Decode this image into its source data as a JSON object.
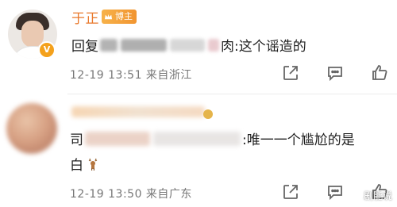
{
  "comments": [
    {
      "username": "于正",
      "badge": "博主",
      "vip_mark": "V",
      "text_prefix": "回复",
      "text_suffix": "肉:这个谣造的",
      "meta": "12-19 13:51 来自浙江"
    },
    {
      "text_line1_prefix": "司",
      "text_line1_suffix": ":唯一一个尴尬的是",
      "text_line2": "白",
      "meta": "12-19 13:50 来自广东"
    }
  ],
  "icons": {
    "share": "share-icon",
    "comment": "comment-icon",
    "like": "like-icon",
    "crown": "crown-icon",
    "deer": "deer-emoji-icon"
  },
  "watermark": {
    "text": "剧能说"
  },
  "colors": {
    "username": "#e9792c",
    "badge": "#f19531",
    "meta": "#777777",
    "text": "#1f1f1f"
  }
}
